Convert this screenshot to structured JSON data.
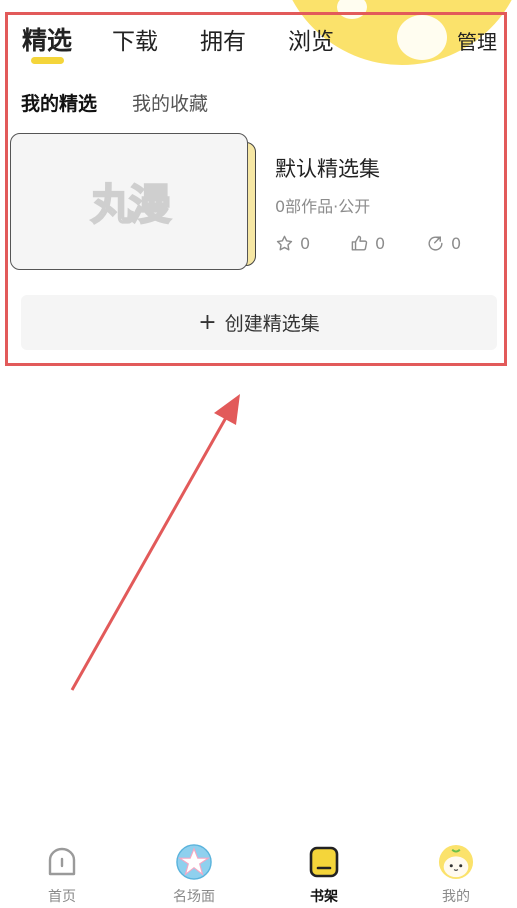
{
  "top_tabs": [
    "精选",
    "下载",
    "拥有",
    "浏览"
  ],
  "manage_label": "管理",
  "sub_tabs": [
    "我的精选",
    "我的收藏"
  ],
  "collection": {
    "title": "默认精选集",
    "meta": "0部作品·公开",
    "cover_logo": "丸漫",
    "stats": {
      "stars": "0",
      "likes": "0",
      "shares": "0"
    }
  },
  "create_button": {
    "plus": "+",
    "label": "创建精选集"
  },
  "bottom_nav": [
    {
      "label": "首页",
      "icon": "home-icon"
    },
    {
      "label": "名场面",
      "icon": "scene-avatar-icon"
    },
    {
      "label": "书架",
      "icon": "bookshelf-icon"
    },
    {
      "label": "我的",
      "icon": "profile-avatar-icon"
    }
  ],
  "colors": {
    "accent": "#f4d53a",
    "annotation": "#e25a5a",
    "muted_text": "#8c8c8c",
    "button_bg": "#f5f5f5"
  }
}
